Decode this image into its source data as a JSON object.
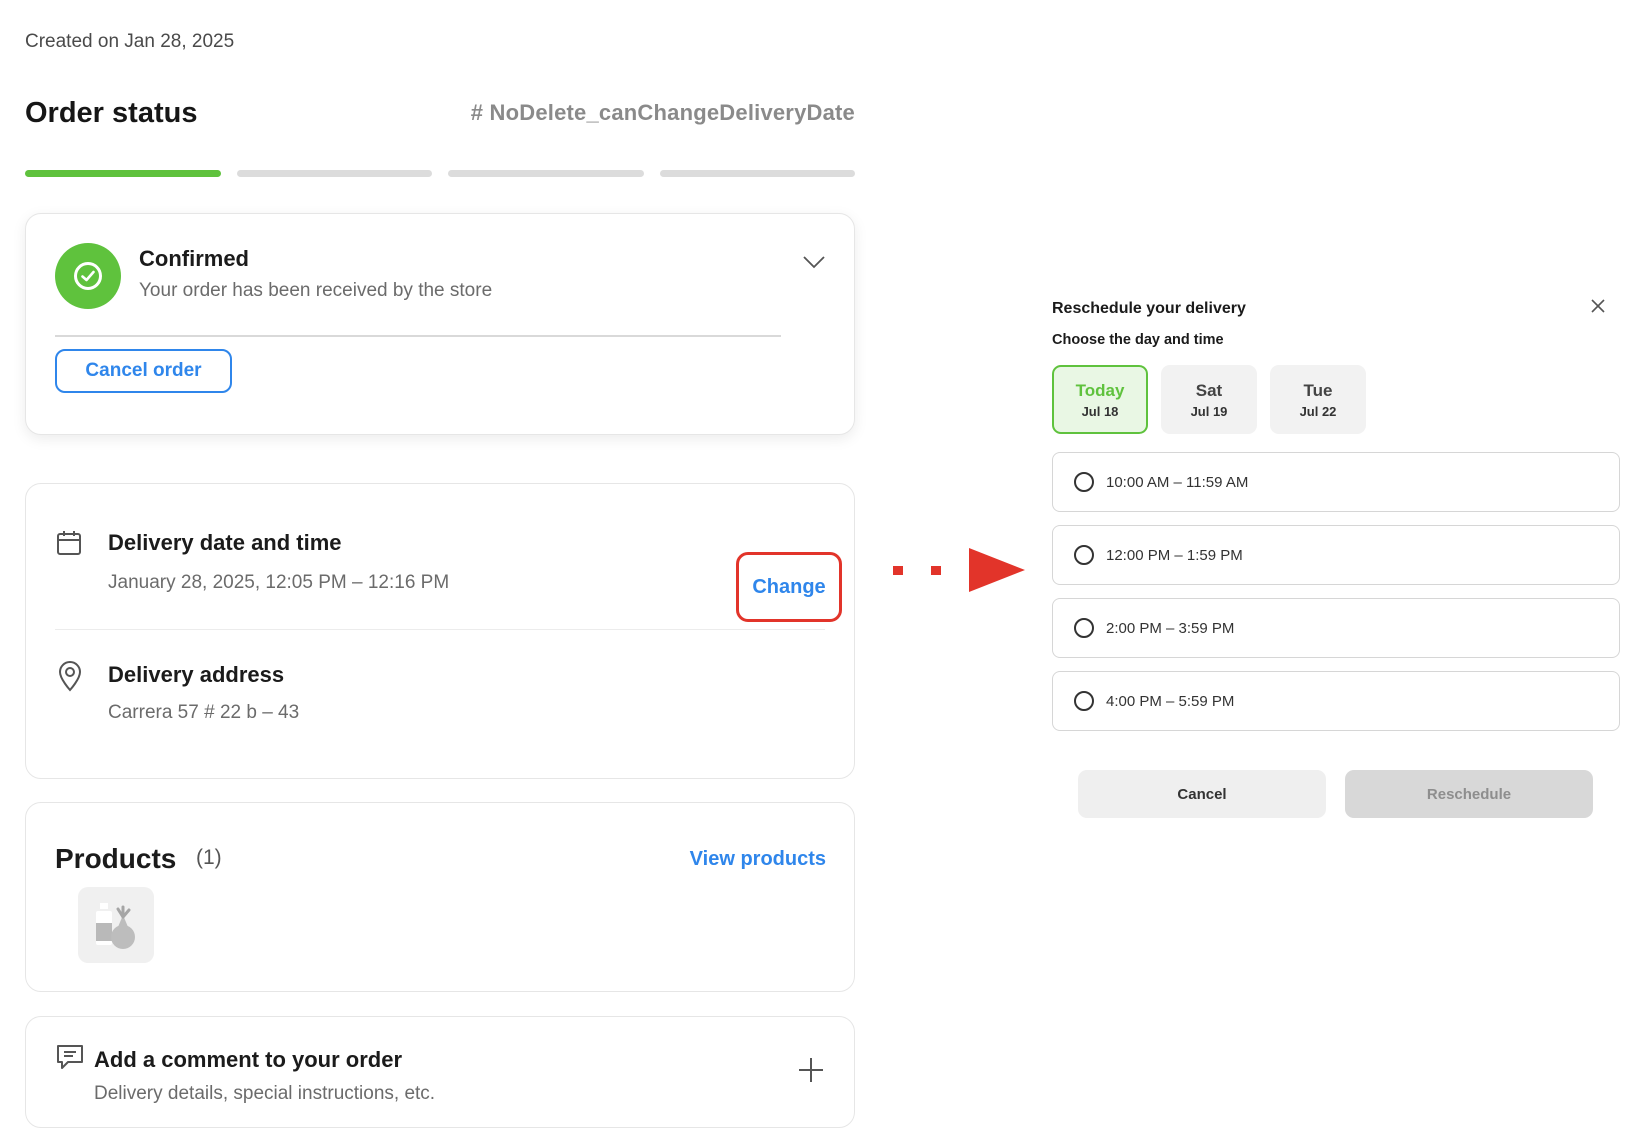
{
  "order": {
    "created": "Created on Jan 28, 2025",
    "status_title": "Order status",
    "order_id": "# NoDelete_canChangeDeliveryDate",
    "progress": {
      "steps_total": 4,
      "steps_completed": 1,
      "accent": "#5fc23d"
    }
  },
  "status_card": {
    "title": "Confirmed",
    "subtitle": "Your order has been received by the store",
    "cancel_label": "Cancel order"
  },
  "delivery": {
    "date_title": "Delivery date and time",
    "date_value": "January 28, 2025, 12:05 PM – 12:16 PM",
    "change_label": "Change",
    "address_title": "Delivery address",
    "address_value": "Carrera 57 # 22 b – 43"
  },
  "products": {
    "title": "Products",
    "count": "(1)",
    "view_label": "View products"
  },
  "comment": {
    "title": "Add a comment to your order",
    "subtitle": "Delivery details, special instructions, etc."
  },
  "modal": {
    "title": "Reschedule your delivery",
    "subtitle": "Choose the day and time",
    "days": [
      {
        "name": "Today",
        "date": "Jul 18",
        "selected": true
      },
      {
        "name": "Sat",
        "date": "Jul 19",
        "selected": false
      },
      {
        "name": "Tue",
        "date": "Jul 22",
        "selected": false
      }
    ],
    "slots": [
      "10:00 AM – 11:59 AM",
      "12:00 PM – 1:59 PM",
      "2:00 PM – 3:59 PM",
      "4:00 PM – 5:59 PM"
    ],
    "cancel_label": "Cancel",
    "reschedule_label": "Reschedule"
  },
  "colors": {
    "brand_green": "#5fc23d",
    "link_blue": "#2f86eb",
    "highlight_red": "#e2342a"
  }
}
